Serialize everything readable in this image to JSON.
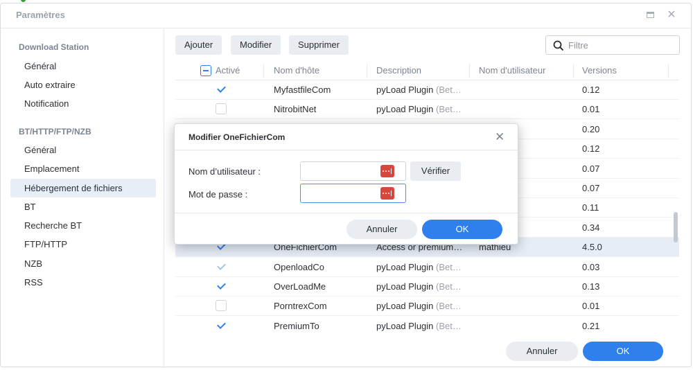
{
  "window": {
    "title": "Paramètres"
  },
  "sidebar": {
    "sections": [
      {
        "title": "Download Station",
        "items": [
          "Général",
          "Auto extraire",
          "Notification"
        ]
      },
      {
        "title": "BT/HTTP/FTP/NZB",
        "items": [
          "Général",
          "Emplacement",
          "Hébergement de fichiers",
          "BT",
          "Recherche BT",
          "FTP/HTTP",
          "NZB",
          "RSS"
        ]
      }
    ],
    "active_item": "Hébergement de fichiers"
  },
  "toolbar": {
    "add_label": "Ajouter",
    "modify_label": "Modifier",
    "delete_label": "Supprimer",
    "search_placeholder": "Filtre"
  },
  "table": {
    "columns": [
      "Activé",
      "Nom d'hôte",
      "Description",
      "Nom d'utilisateur",
      "Versions"
    ],
    "rows": [
      {
        "enabled": "checked",
        "host": "MyfastfileCom",
        "desc": "pyLoad Plugin",
        "desc_suffix": "(Bet…",
        "user": "",
        "version": "0.12"
      },
      {
        "enabled": "unchecked",
        "host": "NitrobitNet",
        "desc": "pyLoad Plugin",
        "desc_suffix": "(Bet…",
        "user": "",
        "version": "0.01"
      },
      {
        "enabled": "hidden",
        "host": "",
        "desc": "",
        "desc_suffix": "",
        "user": "",
        "version": "0.20"
      },
      {
        "enabled": "hidden",
        "host": "",
        "desc": "",
        "desc_suffix": "",
        "user": "",
        "version": "0.12"
      },
      {
        "enabled": "hidden",
        "host": "",
        "desc": "",
        "desc_suffix": "",
        "user": "",
        "version": "0.07"
      },
      {
        "enabled": "hidden",
        "host": "",
        "desc": "",
        "desc_suffix": "",
        "user": "",
        "version": "0.07"
      },
      {
        "enabled": "hidden",
        "host": "",
        "desc": "",
        "desc_suffix": "",
        "user": "",
        "version": "0.11"
      },
      {
        "enabled": "hidden",
        "host": "",
        "desc": "",
        "desc_suffix": "",
        "user": "",
        "version": "0.34"
      },
      {
        "enabled": "checked",
        "host": "OneFichierCom",
        "desc": "Access or premium…",
        "desc_suffix": "",
        "user": "mathieu",
        "version": "4.5.0",
        "selected": true
      },
      {
        "enabled": "dim",
        "host": "OpenloadCo",
        "desc": "pyLoad Plugin",
        "desc_suffix": "(Bet…",
        "user": "",
        "version": "0.03"
      },
      {
        "enabled": "checked",
        "host": "OverLoadMe",
        "desc": "pyLoad Plugin",
        "desc_suffix": "(Bet…",
        "user": "",
        "version": "0.13"
      },
      {
        "enabled": "unchecked",
        "host": "PorntrexCom",
        "desc": "pyLoad Plugin",
        "desc_suffix": "(Bet…",
        "user": "",
        "version": "0.01"
      },
      {
        "enabled": "checked",
        "host": "PremiumTo",
        "desc": "pyLoad Plugin",
        "desc_suffix": "(Bet…",
        "user": "",
        "version": "0.21"
      }
    ]
  },
  "footer": {
    "cancel_label": "Annuler",
    "ok_label": "OK"
  },
  "modal": {
    "title": "Modifier OneFichierCom",
    "username_label": "Nom d’utilisateur :",
    "password_label": "Mot de passe :",
    "username_value": "",
    "password_value": "",
    "verify_label": "Vérifier",
    "cancel_label": "Annuler",
    "ok_label": "OK"
  },
  "colors": {
    "accent": "#2f80ed",
    "password_icon": "#d9473c",
    "selected_row": "#e6edf7",
    "active_sidebar": "#e8eef6"
  }
}
